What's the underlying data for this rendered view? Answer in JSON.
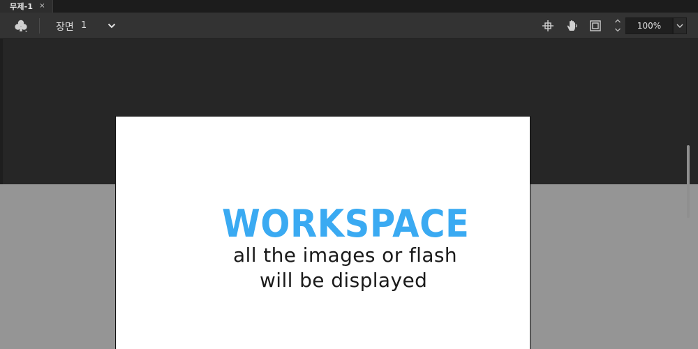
{
  "document_tab": {
    "title": "무제-1",
    "close_glyph": "×"
  },
  "toolbar": {
    "edit_symbols_icon": "club-icon",
    "scene_label": "장면",
    "scene_number": "1",
    "scene_dropdown_icon": "chevron-down-icon",
    "snap_icon": "crosshair-icon",
    "hand_icon": "hand-icon",
    "clip_icon": "clip-stage-icon",
    "zoom_value": "100%"
  },
  "stage": {
    "title": "WORKSPACE",
    "subtitle_line1": "all the images or flash",
    "subtitle_line2": "will be displayed"
  },
  "colors": {
    "accent": "#3aaaf2",
    "toolbar_bg": "#333333",
    "workspace_bg": "#262626",
    "lower_area_bg": "#959595"
  }
}
